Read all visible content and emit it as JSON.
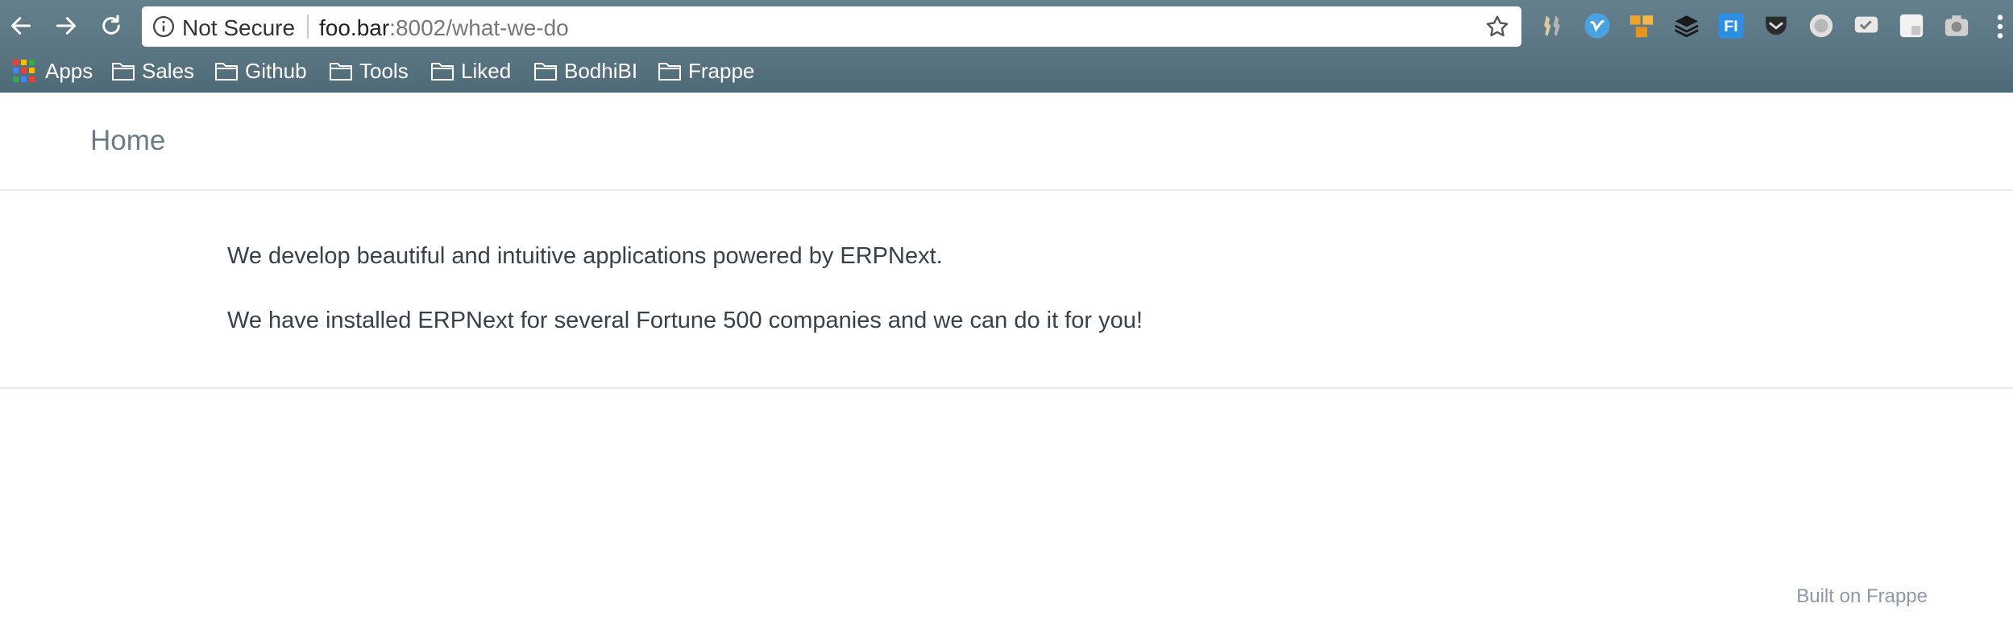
{
  "browser": {
    "security_label": "Not Secure",
    "url_host": "foo.bar",
    "url_path": ":8002/what-we-do",
    "extensions": [
      "key-icon",
      "vimeo-icon",
      "blocks-icon",
      "layers-icon",
      "fi-icon",
      "pocket-icon",
      "record-icon",
      "chat-icon",
      "window-icon",
      "camera-icon"
    ],
    "extension_fi_text": "FI"
  },
  "bookmarks": {
    "apps_label": "Apps",
    "items": [
      {
        "label": "Sales"
      },
      {
        "label": "Github"
      },
      {
        "label": "Tools"
      },
      {
        "label": "Liked"
      },
      {
        "label": "BodhiBI"
      },
      {
        "label": "Frappe"
      }
    ]
  },
  "site": {
    "brand": "Home"
  },
  "content": {
    "paragraphs": [
      "We develop beautiful and intuitive applications powered by ERPNext.",
      "We have installed ERPNext for several Fortune 500 companies and we can do it for you!"
    ]
  },
  "footer": {
    "built_on": "Built on Frappe"
  },
  "colors": {
    "toolbar": "#5a7582",
    "text": "#36414c",
    "muted": "#8d99a6",
    "brand": "#6b7c88"
  }
}
